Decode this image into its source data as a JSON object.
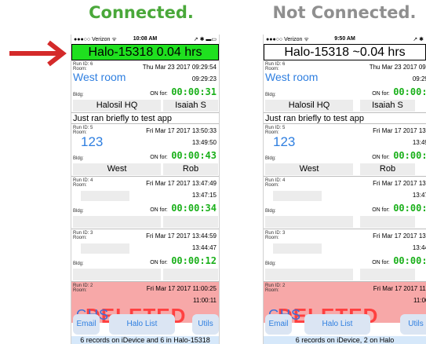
{
  "headings": {
    "connected": "Connected.",
    "not_connected": "Not Connected."
  },
  "colors": {
    "connected_green": "#4aa83a",
    "connected_bar": "#1fe01f",
    "arrow_red": "#d42a2a",
    "room_blue": "#2f7fe0",
    "deleted_bg": "#f7a8a8"
  },
  "connected": {
    "status": {
      "signal": "●●●○○ Verizon ᯤ",
      "time": "10:08 AM",
      "battery": "↗ ✱ ▬▭"
    },
    "title": "Halo-15318 0.04 hrs",
    "runs": [
      {
        "id_label": "Run ID: 6",
        "room_label": "Room:",
        "room": "West room",
        "bldg_label": "Bldg:",
        "date": "Thu Mar 23 2017 09:29:54",
        "end_time": "09:29:23",
        "on_label": "ON for:",
        "on_for": "00:00:31",
        "building": "Halosil HQ",
        "operator": "Isaiah S",
        "note": "Just ran briefly to test app"
      },
      {
        "id_label": "Run ID: 5",
        "room_label": "Room:",
        "room": "123",
        "bldg_label": "Bldg:",
        "date": "Fri Mar 17 2017 13:50:33",
        "end_time": "13:49:50",
        "on_label": "ON for:",
        "on_for": "00:00:43",
        "building": "West",
        "operator": "Rob"
      },
      {
        "id_label": "Run ID: 4",
        "room_label": "Room:",
        "bldg_label": "Bldg:",
        "date": "Fri Mar 17 2017 13:47:49",
        "end_time": "13:47:15",
        "on_label": "ON for:",
        "on_for": "00:00:34"
      },
      {
        "id_label": "Run ID: 3",
        "room_label": "Room:",
        "bldg_label": "Bldg:",
        "date": "Fri Mar 17 2017 13:44:59",
        "end_time": "13:44:47",
        "on_label": "ON for:",
        "on_for": "00:00:12"
      },
      {
        "id_label": "Run ID: 2",
        "room_label": "Room:",
        "date": "Fri Mar 17 2017 11:00:25",
        "end_time": "11:00:11",
        "deleted_ghs": "GHS",
        "deleted_text": "DELETED"
      }
    ],
    "buttons": {
      "email": "Email",
      "halo_list": "Halo List",
      "utils": "Utils"
    },
    "footer": "6 records on iDevice and 6 in Halo-15318"
  },
  "not_connected": {
    "status": {
      "signal": "●●●○○ Verizon ᯤ",
      "time": "9:50 AM",
      "battery": "↗ ✱"
    },
    "title": "Halo-15318 ~0.04 hrs",
    "runs": [
      {
        "id_label": "Run ID: 6",
        "room_label": "Room:",
        "room": "West room",
        "bldg_label": "Bldg:",
        "date": "Thu Mar 23 2017 09:29:54",
        "end_time": "09:29:23",
        "on_label": "ON for:",
        "on_for": "00:00:31",
        "building": "Halosil HQ",
        "operator": "Isaiah S",
        "note": "Just ran briefly to test app"
      },
      {
        "id_label": "Run ID: 5",
        "room_label": "Room:",
        "room": "123",
        "bldg_label": "Bldg:",
        "date": "Fri Mar 17 2017 13:50:33",
        "end_time": "13:49:50",
        "on_label": "ON for:",
        "on_for": "00:00:43",
        "building": "West",
        "operator": "Rob"
      },
      {
        "id_label": "Run ID: 4",
        "room_label": "Room:",
        "bldg_label": "Bldg:",
        "date": "Fri Mar 17 2017 13:47:49",
        "end_time": "13:47:15",
        "on_label": "ON for:",
        "on_for": "00:00:34"
      },
      {
        "id_label": "Run ID: 3",
        "room_label": "Room:",
        "bldg_label": "Bldg:",
        "date": "Fri Mar 17 2017 13:44:59",
        "end_time": "13:44:47",
        "on_label": "ON for:",
        "on_for": "00:00:12"
      },
      {
        "id_label": "Run ID: 2",
        "room_label": "Room:",
        "date": "Fri Mar 17 2017 11:00:25",
        "end_time": "11:00:11",
        "deleted_ghs": "GHS",
        "deleted_text": "DELETED"
      }
    ],
    "buttons": {
      "email": "Email",
      "halo_list": "Halo List",
      "utils": "Utils"
    },
    "footer": "6 records on iDevice, 2 on Halo"
  }
}
